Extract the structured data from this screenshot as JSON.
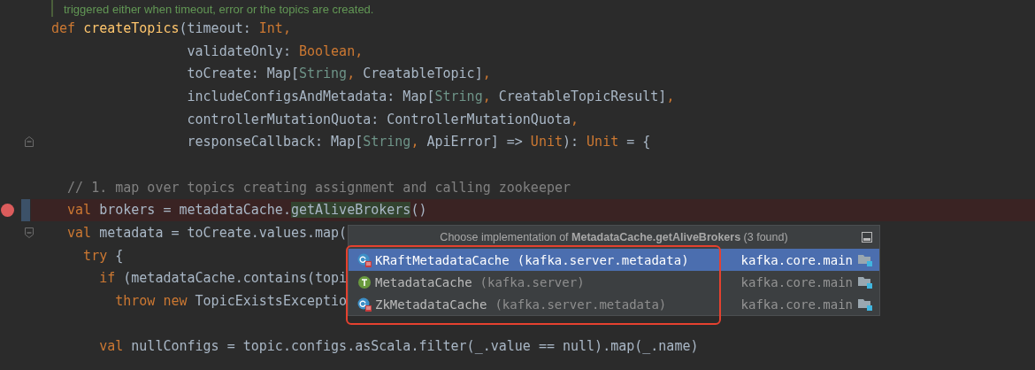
{
  "editor": {
    "lines": [
      {
        "kind": "doc",
        "tokens": [
          {
            "kind": "doc",
            "text": "triggered either when timeout, error or the topics are created."
          }
        ]
      },
      {
        "kind": "code",
        "tokens": [
          {
            "kind": "keyword",
            "text": "def "
          },
          {
            "kind": "function",
            "text": "createTopics"
          },
          {
            "kind": "plain",
            "text": "(timeout: "
          },
          {
            "kind": "type",
            "text": "Int"
          },
          {
            "kind": "punct",
            "text": ","
          }
        ]
      },
      {
        "kind": "code",
        "tokens": [
          {
            "kind": "plain",
            "text": "                 validateOnly: "
          },
          {
            "kind": "type",
            "text": "Boolean"
          },
          {
            "kind": "punct",
            "text": ","
          }
        ]
      },
      {
        "kind": "code",
        "tokens": [
          {
            "kind": "plain",
            "text": "                 toCreate: Map["
          },
          {
            "kind": "string_type",
            "text": "String"
          },
          {
            "kind": "punct",
            "text": ", "
          },
          {
            "kind": "plain",
            "text": "CreatableTopic]"
          },
          {
            "kind": "punct",
            "text": ","
          }
        ]
      },
      {
        "kind": "code",
        "tokens": [
          {
            "kind": "plain",
            "text": "                 includeConfigsAndMetadata: Map["
          },
          {
            "kind": "string_type",
            "text": "String"
          },
          {
            "kind": "punct",
            "text": ", "
          },
          {
            "kind": "plain",
            "text": "CreatableTopicResult]"
          },
          {
            "kind": "punct",
            "text": ","
          }
        ]
      },
      {
        "kind": "code",
        "tokens": [
          {
            "kind": "plain",
            "text": "                 controllerMutationQuota: ControllerMutationQuota"
          },
          {
            "kind": "punct",
            "text": ","
          }
        ]
      },
      {
        "kind": "code",
        "fold_end": true,
        "tokens": [
          {
            "kind": "plain",
            "text": "                 responseCallback: Map["
          },
          {
            "kind": "string_type",
            "text": "String"
          },
          {
            "kind": "punct",
            "text": ", "
          },
          {
            "kind": "plain",
            "text": "ApiError] => "
          },
          {
            "kind": "type",
            "text": "Unit"
          },
          {
            "kind": "plain",
            "text": "): "
          },
          {
            "kind": "type",
            "text": "Unit"
          },
          {
            "kind": "plain",
            "text": " = {"
          }
        ]
      },
      {
        "kind": "blank"
      },
      {
        "kind": "code",
        "tokens": [
          {
            "kind": "comment",
            "text": "  // 1. map over topics creating assignment and calling zookeeper"
          }
        ]
      },
      {
        "kind": "code",
        "breakpoint": true,
        "tokens": [
          {
            "kind": "keyword",
            "text": "  val"
          },
          {
            "kind": "plain",
            "text": " brokers = metadataCache."
          },
          {
            "kind": "highlight",
            "text": "getAliveBrokers"
          },
          {
            "kind": "plain",
            "text": "()"
          }
        ]
      },
      {
        "kind": "code",
        "fold_start": true,
        "tokens": [
          {
            "kind": "keyword",
            "text": "  val"
          },
          {
            "kind": "plain",
            "text": " metadata = toCreate.values.map("
          }
        ]
      },
      {
        "kind": "code",
        "tokens": [
          {
            "kind": "keyword",
            "text": "    try"
          },
          {
            "kind": "plain",
            "text": " {"
          }
        ]
      },
      {
        "kind": "code",
        "tokens": [
          {
            "kind": "keyword",
            "text": "      if"
          },
          {
            "kind": "plain",
            "text": " (metadataCache.contains(topi"
          }
        ]
      },
      {
        "kind": "code",
        "tokens": [
          {
            "kind": "keyword",
            "text": "        throw new"
          },
          {
            "kind": "plain",
            "text": " TopicExistsExceptio"
          }
        ]
      },
      {
        "kind": "blank"
      },
      {
        "kind": "code",
        "tokens": [
          {
            "kind": "keyword",
            "text": "      val"
          },
          {
            "kind": "plain",
            "text": " nullConfigs = topic.configs.asScala.filter(_.value == null).map(_.name)"
          }
        ]
      }
    ]
  },
  "popup": {
    "title": "Choose implementation of **MetadataCache.getAliveBrokers** (3 found)",
    "items": [
      {
        "kind": "class",
        "name": "KRaftMetadataCache",
        "package": "(kafka.server.metadata)",
        "module": "kafka.core.main",
        "selected": true
      },
      {
        "kind": "trait",
        "name": "MetadataCache",
        "package": "(kafka.server)",
        "module": "kafka.core.main",
        "selected": false
      },
      {
        "kind": "class",
        "name": "ZkMetadataCache",
        "package": "(kafka.server.metadata)",
        "module": "kafka.core.main",
        "selected": false
      }
    ]
  }
}
